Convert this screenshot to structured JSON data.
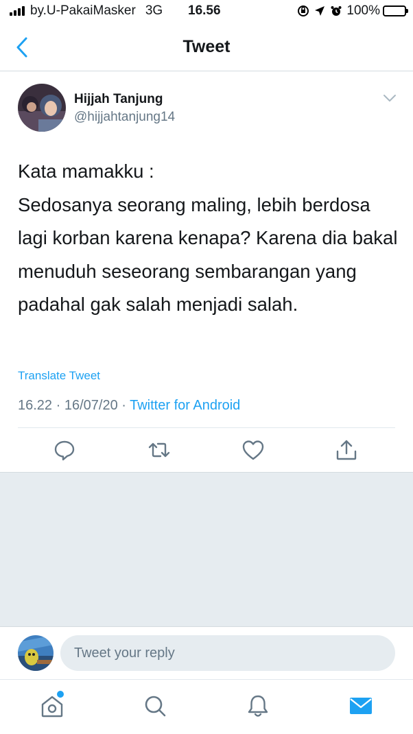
{
  "status_bar": {
    "carrier": "by.U-PakaiMasker",
    "network": "3G",
    "time": "16.56",
    "battery": "100%"
  },
  "header": {
    "title": "Tweet"
  },
  "tweet": {
    "author_name": "Hijjah Tanjung",
    "author_handle": "@hijjahtanjung14",
    "text": "Kata mamakku :\nSedosanya seorang maling, lebih berdosa lagi korban karena kenapa? Karena dia bakal menuduh seseorang sembarangan yang padahal gak salah menjadi salah.",
    "translate_label": "Translate Tweet",
    "time": "16.22",
    "date": "16/07/20",
    "client": "Twitter for Android"
  },
  "reply": {
    "placeholder": "Tweet your reply"
  },
  "colors": {
    "accent": "#1da1f2",
    "secondary_text": "#657786",
    "background_gray": "#e6ecf0"
  },
  "icons": {
    "back": "chevron-left-icon",
    "menu": "chevron-down-icon",
    "reply": "comment-icon",
    "retweet": "retweet-icon",
    "like": "heart-icon",
    "share": "share-icon",
    "home": "home-icon",
    "search": "search-icon",
    "notifications": "bell-icon",
    "messages": "mail-icon"
  }
}
